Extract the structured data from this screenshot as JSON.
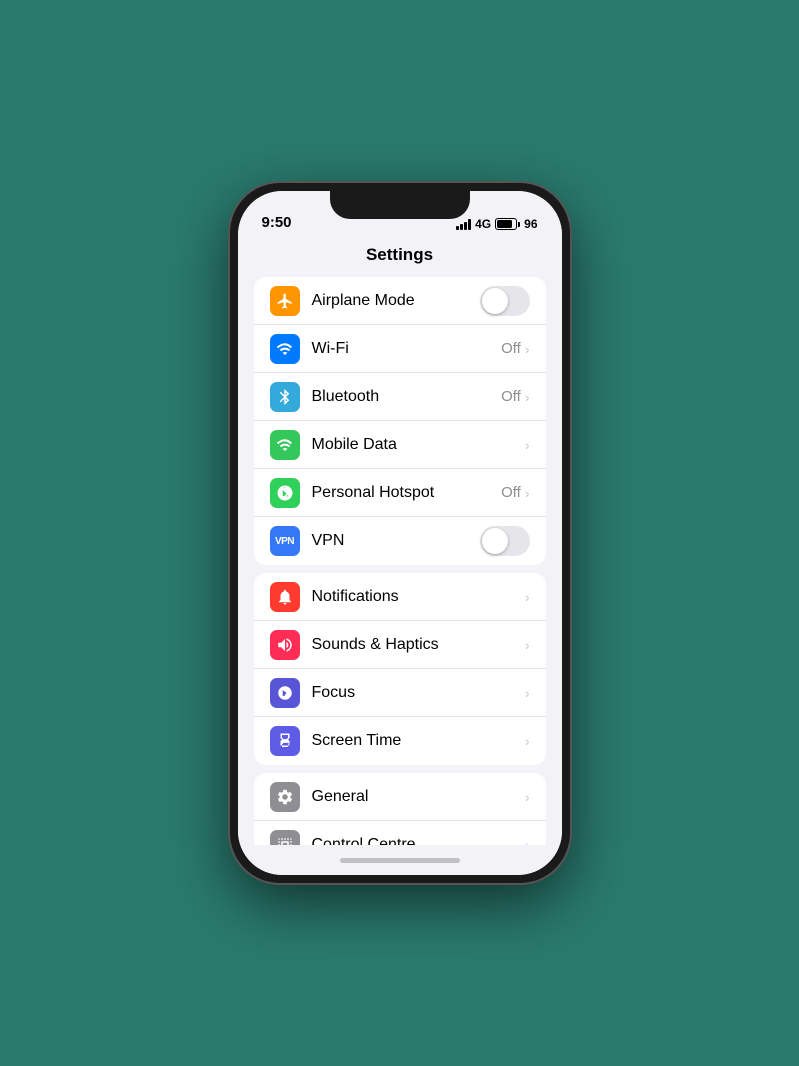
{
  "phone": {
    "status": {
      "time": "9:50",
      "signal_label": "4G",
      "battery_label": "96"
    },
    "title": "Settings",
    "groups": [
      {
        "id": "connectivity",
        "rows": [
          {
            "id": "airplane-mode",
            "label": "Airplane Mode",
            "icon_color": "orange",
            "icon_type": "airplane",
            "right_type": "toggle",
            "toggle_on": false
          },
          {
            "id": "wifi",
            "label": "Wi-Fi",
            "icon_color": "blue",
            "icon_type": "wifi",
            "right_type": "value_chevron",
            "value": "Off"
          },
          {
            "id": "bluetooth",
            "label": "Bluetooth",
            "icon_color": "blue-bright",
            "icon_type": "bluetooth",
            "right_type": "value_chevron",
            "value": "Off"
          },
          {
            "id": "mobile-data",
            "label": "Mobile Data",
            "icon_color": "green",
            "icon_type": "antenna",
            "right_type": "chevron"
          },
          {
            "id": "personal-hotspot",
            "label": "Personal Hotspot",
            "icon_color": "green2",
            "icon_type": "hotspot",
            "right_type": "value_chevron",
            "value": "Off"
          },
          {
            "id": "vpn",
            "label": "VPN",
            "icon_color": "vpn",
            "icon_type": "vpn",
            "right_type": "toggle",
            "toggle_on": false
          }
        ]
      },
      {
        "id": "notifications-group",
        "rows": [
          {
            "id": "notifications",
            "label": "Notifications",
            "icon_color": "red",
            "icon_type": "bell",
            "right_type": "chevron"
          },
          {
            "id": "sounds-haptics",
            "label": "Sounds & Haptics",
            "icon_color": "red2",
            "icon_type": "speaker",
            "right_type": "chevron"
          },
          {
            "id": "focus",
            "label": "Focus",
            "icon_color": "indigo",
            "icon_type": "moon",
            "right_type": "chevron"
          },
          {
            "id": "screen-time",
            "label": "Screen Time",
            "icon_color": "purple",
            "icon_type": "hourglass",
            "right_type": "chevron"
          }
        ]
      },
      {
        "id": "general-group",
        "rows": [
          {
            "id": "general",
            "label": "General",
            "icon_color": "gray",
            "icon_type": "gear",
            "right_type": "chevron"
          },
          {
            "id": "control-centre",
            "label": "Control Centre",
            "icon_color": "gray",
            "icon_type": "sliders",
            "right_type": "chevron"
          }
        ]
      }
    ]
  }
}
